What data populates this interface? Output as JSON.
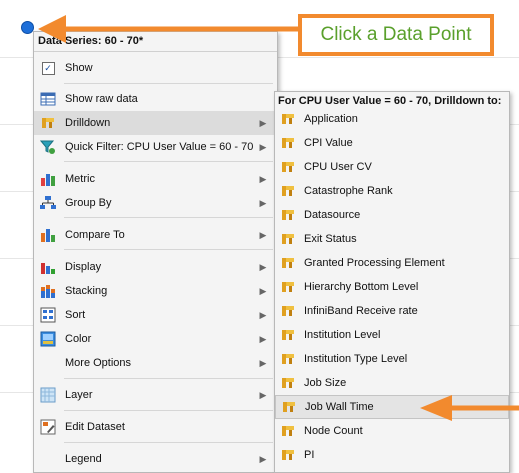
{
  "callout": {
    "text": "Click a Data Point"
  },
  "menu": {
    "header": "Data Series: 60 - 70*",
    "items": [
      {
        "label": "Show",
        "icon": "checkbox-icon",
        "submenu": false
      },
      {
        "label": "Show raw data",
        "icon": "table-icon",
        "submenu": false
      },
      {
        "label": "Drilldown",
        "icon": "drilldown-icon",
        "submenu": true
      },
      {
        "label": "Quick Filter: CPU User Value = 60 - 70",
        "icon": "filter-icon",
        "submenu": true
      },
      {
        "label": "Metric",
        "icon": "bar-chart-icon",
        "submenu": true
      },
      {
        "label": "Group By",
        "icon": "hierarchy-icon",
        "submenu": true
      },
      {
        "label": "Compare To",
        "icon": "compare-chart-icon",
        "submenu": true
      },
      {
        "label": "Display",
        "icon": "display-chart-icon",
        "submenu": true
      },
      {
        "label": "Stacking",
        "icon": "stacking-chart-icon",
        "submenu": true
      },
      {
        "label": "Sort",
        "icon": "sort-icon",
        "submenu": true
      },
      {
        "label": "Color",
        "icon": "color-icon",
        "submenu": true
      },
      {
        "label": "More Options",
        "icon": "",
        "submenu": true
      },
      {
        "label": "Layer",
        "icon": "layer-icon",
        "submenu": true
      },
      {
        "label": "Edit Dataset",
        "icon": "edit-dataset-icon",
        "submenu": false
      },
      {
        "label": "Legend",
        "icon": "",
        "submenu": true
      }
    ]
  },
  "submenu": {
    "header": "For CPU User Value = 60 - 70, Drilldown to:",
    "items": [
      "Application",
      "CPI Value",
      "CPU User CV",
      "Catastrophe Rank",
      "Datasource",
      "Exit Status",
      "Granted Processing Element",
      "Hierarchy Bottom Level",
      "InfiniBand Receive rate",
      "Institution Level",
      "Institution Type Level",
      "Job Size",
      "Job Wall Time",
      "Node Count",
      "PI"
    ],
    "highlighted": "Job Wall Time"
  },
  "colors": {
    "callout_border": "#f28a2e",
    "callout_text": "#5aa02c",
    "data_point": "#1e6fd9"
  }
}
